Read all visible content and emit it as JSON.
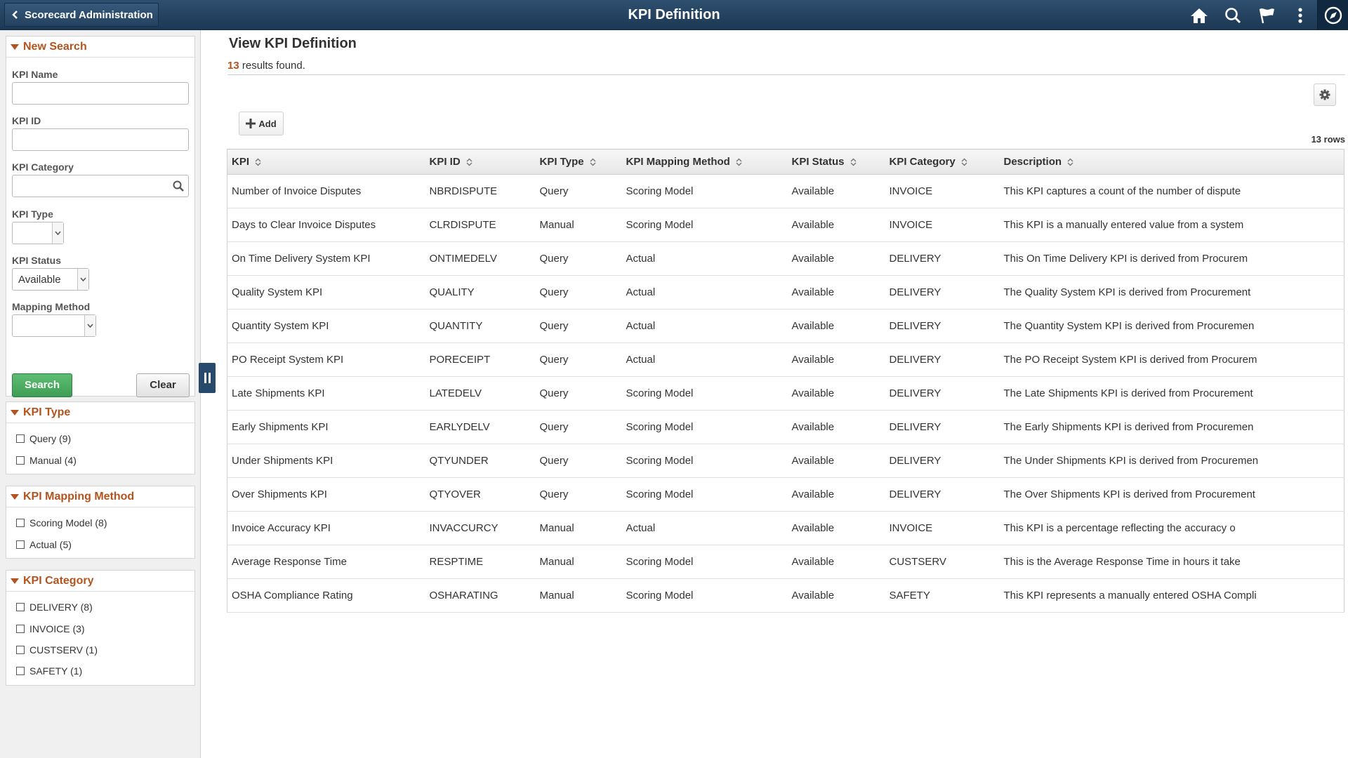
{
  "banner": {
    "back_label": "Scorecard Administration",
    "title": "KPI Definition",
    "icons": [
      "home-icon",
      "search-icon",
      "flag-icon",
      "more-icon",
      "navbar-icon"
    ]
  },
  "search": {
    "header": "New Search",
    "kpi_name_label": "KPI Name",
    "kpi_name_value": "",
    "kpi_id_label": "KPI ID",
    "kpi_id_value": "",
    "kpi_category_label": "KPI Category",
    "kpi_category_value": "",
    "kpi_type_label": "KPI Type",
    "kpi_type_value": "",
    "kpi_status_label": "KPI Status",
    "kpi_status_value": "Available",
    "mapping_method_label": "Mapping Method",
    "mapping_method_value": "",
    "search_button": "Search",
    "clear_button": "Clear"
  },
  "facets": [
    {
      "header": "KPI Type",
      "items": [
        {
          "label": "Query (9)"
        },
        {
          "label": "Manual (4)"
        }
      ]
    },
    {
      "header": "KPI Mapping Method",
      "items": [
        {
          "label": "Scoring Model (8)"
        },
        {
          "label": "Actual (5)"
        }
      ]
    },
    {
      "header": "KPI Category",
      "items": [
        {
          "label": "DELIVERY (8)"
        },
        {
          "label": "INVOICE (3)"
        },
        {
          "label": "CUSTSERV (1)"
        },
        {
          "label": "SAFETY (1)"
        }
      ]
    }
  ],
  "main": {
    "title": "View KPI Definition",
    "results_count": "13",
    "results_text": " results found.",
    "add_label": "Add",
    "rows_label": "13 rows"
  },
  "table": {
    "columns": [
      "KPI",
      "KPI ID",
      "KPI Type",
      "KPI Mapping Method",
      "KPI Status",
      "KPI Category",
      "Description"
    ],
    "rows": [
      [
        "Number of Invoice Disputes",
        "NBRDISPUTE",
        "Query",
        "Scoring Model",
        "Available",
        "INVOICE",
        "This KPI captures a count of the number of dispute"
      ],
      [
        "Days to Clear Invoice Disputes",
        "CLRDISPUTE",
        "Manual",
        "Scoring Model",
        "Available",
        "INVOICE",
        "This KPI is a manually entered value from a system"
      ],
      [
        "On Time Delivery System KPI",
        "ONTIMEDELV",
        "Query",
        "Actual",
        "Available",
        "DELIVERY",
        "This On Time Delivery KPI is derived from Procurem"
      ],
      [
        "Quality System KPI",
        "QUALITY",
        "Query",
        "Actual",
        "Available",
        "DELIVERY",
        "The Quality System KPI is derived from Procurement"
      ],
      [
        "Quantity System KPI",
        "QUANTITY",
        "Query",
        "Actual",
        "Available",
        "DELIVERY",
        "The Quantity System KPI is derived from Procuremen"
      ],
      [
        "PO Receipt System KPI",
        "PORECEIPT",
        "Query",
        "Actual",
        "Available",
        "DELIVERY",
        "The PO Receipt System KPI is derived from Procurem"
      ],
      [
        "Late Shipments KPI",
        "LATEDELV",
        "Query",
        "Scoring Model",
        "Available",
        "DELIVERY",
        "The Late Shipments KPI is derived from Procurement"
      ],
      [
        "Early Shipments KPI",
        "EARLYDELV",
        "Query",
        "Scoring Model",
        "Available",
        "DELIVERY",
        "The Early Shipments KPI is derived from Procuremen"
      ],
      [
        "Under Shipments KPI",
        "QTYUNDER",
        "Query",
        "Scoring Model",
        "Available",
        "DELIVERY",
        "The Under Shipments KPI is derived from Procuremen"
      ],
      [
        "Over Shipments KPI",
        "QTYOVER",
        "Query",
        "Scoring Model",
        "Available",
        "DELIVERY",
        "The Over Shipments KPI is derived from Procurement"
      ],
      [
        "Invoice Accuracy KPI",
        "INVACCURCY",
        "Manual",
        "Actual",
        "Available",
        "INVOICE",
        "This KPI is a percentage reflecting the accuracy o"
      ],
      [
        "Average Response Time",
        "RESPTIME",
        "Manual",
        "Scoring Model",
        "Available",
        "CUSTSERV",
        "This is the Average Response Time in hours it take"
      ],
      [
        "OSHA Compliance Rating",
        "OSHARATING",
        "Manual",
        "Scoring Model",
        "Available",
        "SAFETY",
        "This KPI represents a manually entered OSHA Compli"
      ]
    ]
  }
}
